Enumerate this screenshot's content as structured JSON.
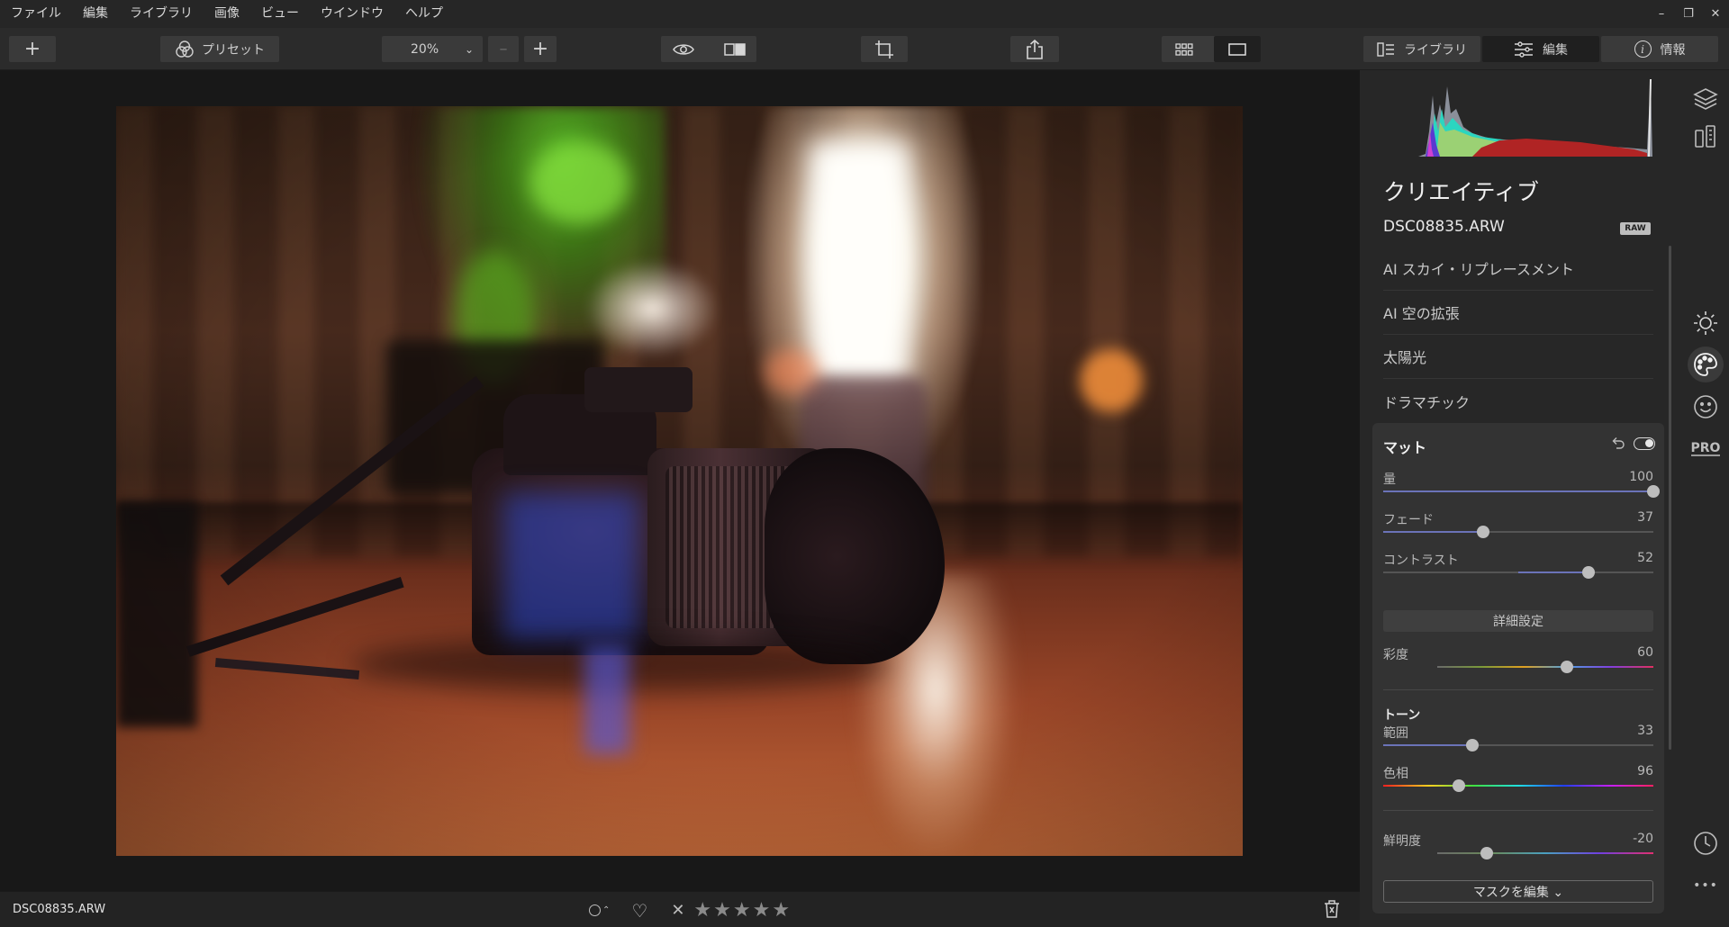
{
  "menu": {
    "items": [
      "ファイル",
      "編集",
      "ライブラリ",
      "画像",
      "ビュー",
      "ウインドウ",
      "ヘルプ"
    ]
  },
  "window_controls": {
    "minimize": "–",
    "restore": "❐",
    "close": "✕"
  },
  "toolbar": {
    "add": "+",
    "presets_label": "プリセット",
    "zoom_value": "20%",
    "zoom_arrow": "⌄",
    "zoom_out": "–",
    "zoom_in": "+",
    "tabs": [
      {
        "label": "ライブラリ",
        "icon": "library-icon"
      },
      {
        "label": "編集",
        "icon": "sliders-icon"
      },
      {
        "label": "情報",
        "icon": "info-icon"
      }
    ],
    "info_glyph": "i"
  },
  "bottom": {
    "filename": "DSC08835.ARW",
    "flag_caret": "⌃",
    "rating": 0,
    "star": "★",
    "reject": "✕",
    "heart": "♡"
  },
  "panel": {
    "title": "クリエイティブ",
    "filename": "DSC08835.ARW",
    "raw_badge": "RAW",
    "tools": [
      "AI スカイ・リプレースメント",
      "AI 空の拡張",
      "太陽光",
      "ドラマチック"
    ],
    "matte": {
      "title": "マット",
      "sliders": [
        {
          "label": "量",
          "value": "100",
          "pos": 1.0
        },
        {
          "label": "フェード",
          "value": "37",
          "pos": 0.37
        },
        {
          "label": "コントラスト",
          "value": "52",
          "pos": 0.76
        }
      ],
      "advanced_label": "詳細設定",
      "saturation": {
        "label": "彩度",
        "value": "60",
        "pos": 0.6
      },
      "tone_title": "トーン",
      "tone_sliders": [
        {
          "label": "範囲",
          "value": "33",
          "pos": 0.33
        },
        {
          "label": "色相",
          "value": "96",
          "pos": 0.28
        }
      ],
      "vibrance": {
        "label": "鮮明度",
        "value": "-20",
        "pos": 0.23
      },
      "mask_button": "マスクを編集 ⌄"
    }
  },
  "rail": {
    "pro_label": "PRO",
    "more": "•••"
  },
  "colors": {
    "accent_slider": "#6b73b8",
    "panel_bg": "#272727",
    "card_bg": "#333333"
  }
}
